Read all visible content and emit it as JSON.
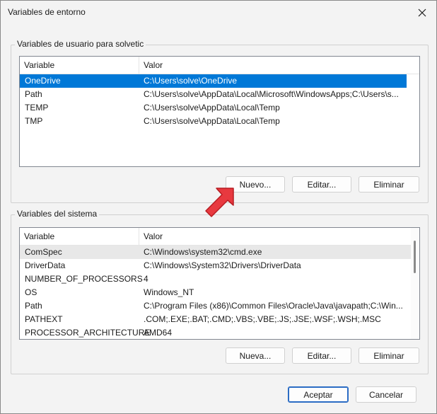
{
  "window": {
    "title": "Variables de entorno"
  },
  "user_vars": {
    "group_label": "Variables de usuario para solvetic",
    "columns": [
      "Variable",
      "Valor"
    ],
    "rows": [
      {
        "variable": "OneDrive",
        "value": "C:\\Users\\solve\\OneDrive",
        "selected": true
      },
      {
        "variable": "Path",
        "value": "C:\\Users\\solve\\AppData\\Local\\Microsoft\\WindowsApps;C:\\Users\\s..."
      },
      {
        "variable": "TEMP",
        "value": "C:\\Users\\solve\\AppData\\Local\\Temp"
      },
      {
        "variable": "TMP",
        "value": "C:\\Users\\solve\\AppData\\Local\\Temp"
      }
    ],
    "buttons": {
      "new": "Nuevo...",
      "edit": "Editar...",
      "delete": "Eliminar"
    }
  },
  "system_vars": {
    "group_label": "Variables del sistema",
    "columns": [
      "Variable",
      "Valor"
    ],
    "rows": [
      {
        "variable": "ComSpec",
        "value": "C:\\Windows\\system32\\cmd.exe",
        "highlighted": true
      },
      {
        "variable": "DriverData",
        "value": "C:\\Windows\\System32\\Drivers\\DriverData"
      },
      {
        "variable": "NUMBER_OF_PROCESSORS",
        "value": "4"
      },
      {
        "variable": "OS",
        "value": "Windows_NT"
      },
      {
        "variable": "Path",
        "value": "C:\\Program Files (x86)\\Common Files\\Oracle\\Java\\javapath;C:\\Win..."
      },
      {
        "variable": "PATHEXT",
        "value": ".COM;.EXE;.BAT;.CMD;.VBS;.VBE;.JS;.JSE;.WSF;.WSH;.MSC"
      },
      {
        "variable": "PROCESSOR_ARCHITECTURE",
        "value": "AMD64"
      }
    ],
    "buttons": {
      "new": "Nueva...",
      "edit": "Editar...",
      "delete": "Eliminar"
    }
  },
  "footer": {
    "accept": "Aceptar",
    "cancel": "Cancelar"
  },
  "colors": {
    "selection": "#0078d7",
    "annotation_arrow": "#e8393f"
  },
  "icons": {
    "close": "close-icon",
    "annotation": "pointer-arrow-annotation"
  }
}
